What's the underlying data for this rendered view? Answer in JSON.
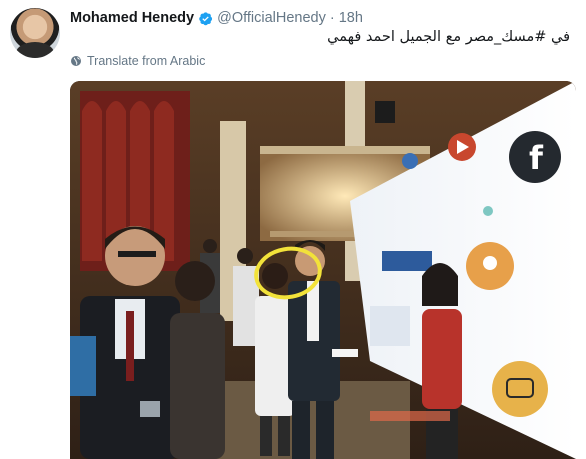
{
  "author": {
    "display_name": "Mohamed Henedy",
    "handle": "@OfficialHenedy",
    "separator": "·",
    "timestamp": "18h",
    "verified": true
  },
  "tweet": {
    "text": "في #مسك_مصر  مع الجميل احمد فهمي",
    "translate_label": "Translate from Arabic"
  },
  "media": {
    "type": "photo",
    "highlight_color": "#f2e23a",
    "accent_colors": [
      "#1d2a3a",
      "#c8472e",
      "#e7b24a",
      "#7ec7c2"
    ]
  },
  "icons": [
    "verified-badge-icon",
    "globe-icon",
    "facebook-icon",
    "youtube-icon",
    "location-pin-icon",
    "chat-bubble-icon"
  ]
}
